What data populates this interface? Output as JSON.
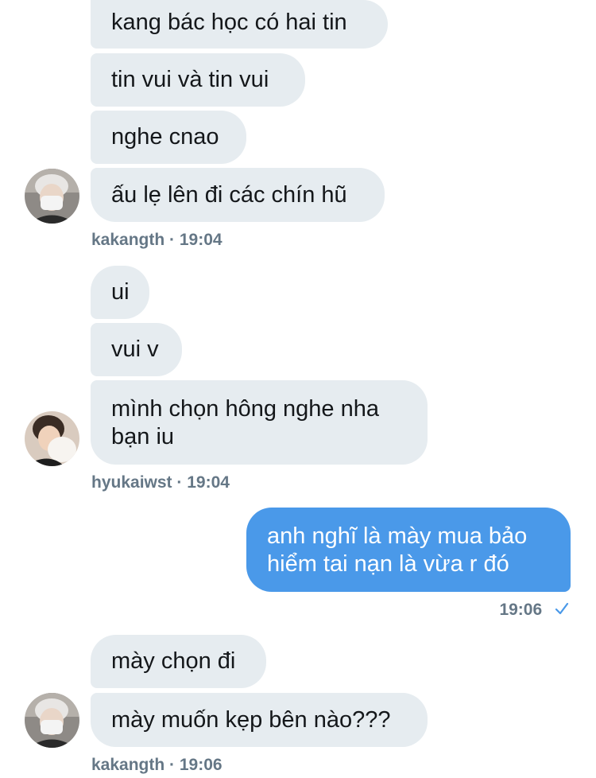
{
  "groups": [
    {
      "sender": "kakangth",
      "time": "19:04",
      "messages": [
        "kang bác học có hai tin",
        "tin vui và tin vui",
        "nghe cnao",
        "ấu lẹ lên đi các chín hũ"
      ]
    },
    {
      "sender": "hyukaiwst",
      "time": "19:04",
      "messages": [
        "ui",
        "vui v",
        "mình chọn hông nghe nha bạn iu"
      ]
    },
    {
      "sender": "me",
      "time": "19:06",
      "status": "sent-check-icon",
      "messages": [
        "anh nghĩ là mày mua bảo hiểm tai nạn là vừa r đó"
      ]
    },
    {
      "sender": "kakangth",
      "time": "19:06",
      "messages": [
        "mày chọn đi",
        "mày muốn kẹp bên nào???"
      ]
    }
  ],
  "colors": {
    "incoming_bubble": "#e6ecf0",
    "outgoing_bubble": "#4a99e9",
    "meta_text": "#657786",
    "check": "#4a99e9"
  }
}
